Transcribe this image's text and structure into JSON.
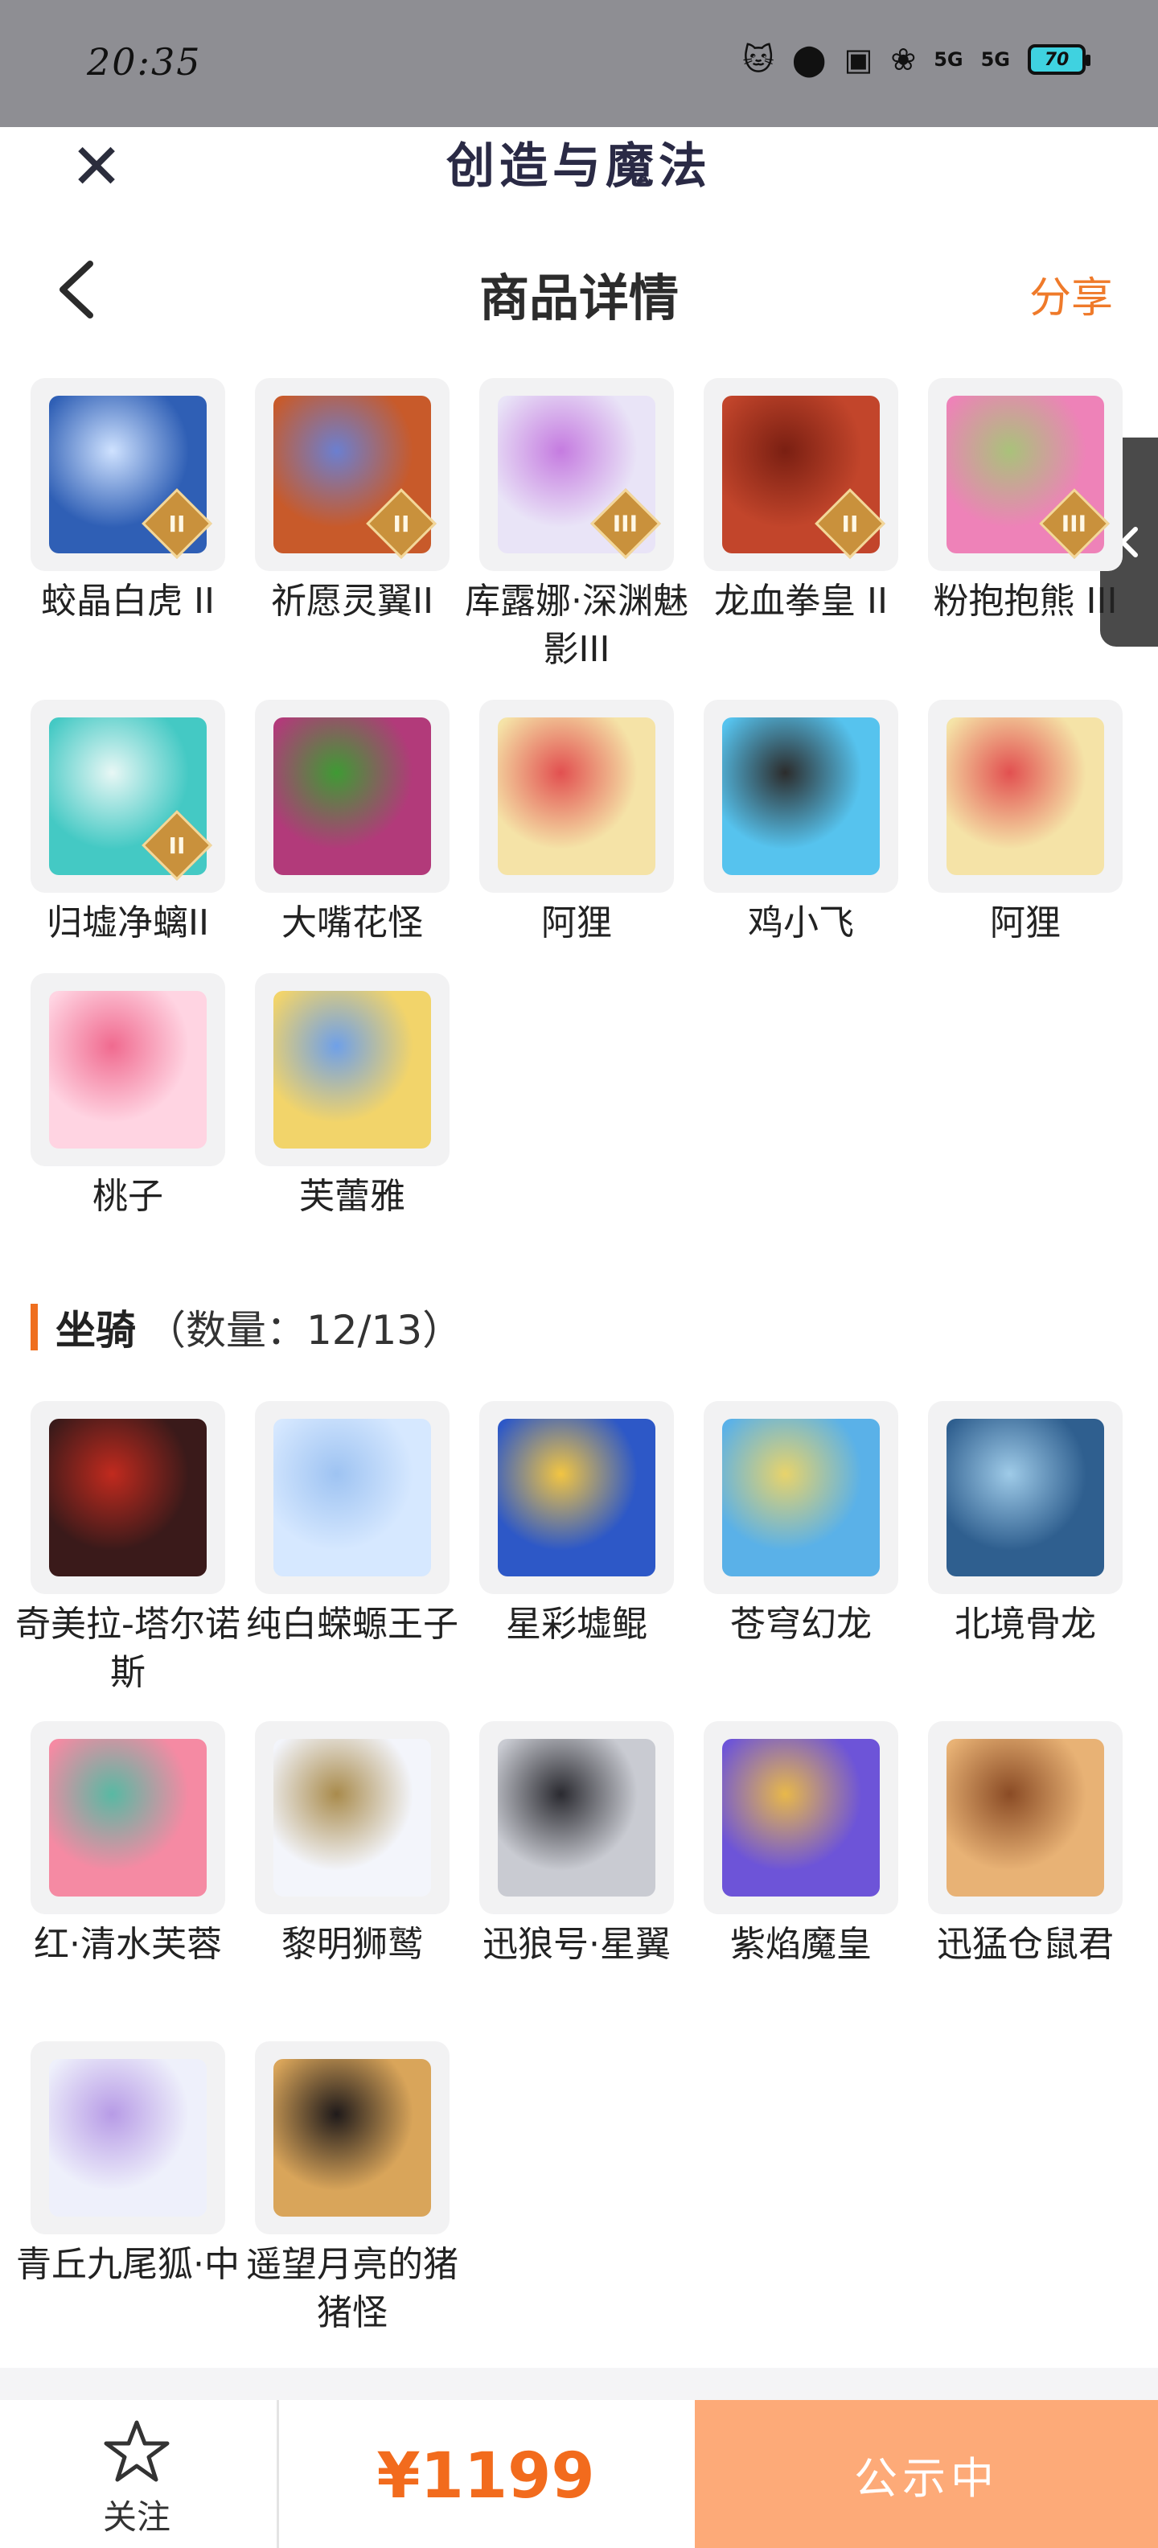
{
  "status_bar": {
    "time": "20:35",
    "signal_1": "5G",
    "signal_2": "5G",
    "battery": "70"
  },
  "header": {
    "app_title": "创造与魔法",
    "page_title": "商品详情",
    "share_label": "分享"
  },
  "pets": [
    {
      "name": "蛟晶白虎 II",
      "badge": "II",
      "colors": [
        "#2f5fb5",
        "#cfe2ff"
      ]
    },
    {
      "name": "祈愿灵翼II",
      "badge": "II",
      "colors": [
        "#c85a2a",
        "#6b7fd0"
      ]
    },
    {
      "name": "库露娜·深渊魅影III",
      "badge": "III",
      "colors": [
        "#e9e4f7",
        "#c57be0"
      ]
    },
    {
      "name": "龙血拳皇 II",
      "badge": "II",
      "colors": [
        "#c2452b",
        "#7a1f12"
      ]
    },
    {
      "name": "粉抱抱熊 III",
      "badge": "III",
      "colors": [
        "#ee82b8",
        "#a9c27a"
      ]
    },
    {
      "name": "归墟净螭II",
      "badge": "II",
      "colors": [
        "#44c9c4",
        "#e8f7f5"
      ]
    },
    {
      "name": "大嘴花怪",
      "badge": "",
      "colors": [
        "#b23a7a",
        "#3f9a34"
      ]
    },
    {
      "name": "阿狸",
      "badge": "",
      "colors": [
        "#f5e3a7",
        "#e25050"
      ]
    },
    {
      "name": "鸡小飞",
      "badge": "",
      "colors": [
        "#56c3ee",
        "#2c2c2c"
      ]
    },
    {
      "name": "阿狸",
      "badge": "",
      "colors": [
        "#f5e3a7",
        "#e25050"
      ]
    },
    {
      "name": "桃子",
      "badge": "",
      "colors": [
        "#ffd4e2",
        "#f06a8f"
      ]
    },
    {
      "name": "芙蕾雅",
      "badge": "",
      "colors": [
        "#f2d46a",
        "#6fa0e8"
      ]
    }
  ],
  "mounts_section": {
    "title": "坐骑",
    "count": "（数量：12/13）"
  },
  "mounts": [
    {
      "name": "奇美拉-塔尔诺斯",
      "badge": "",
      "colors": [
        "#3a1a1a",
        "#c12a1e"
      ]
    },
    {
      "name": "纯白蝾螈王子",
      "badge": "",
      "colors": [
        "#d6e8ff",
        "#9ec3f2"
      ]
    },
    {
      "name": "星彩墟鲲",
      "badge": "",
      "colors": [
        "#2d58c7",
        "#f2c542"
      ]
    },
    {
      "name": "苍穹幻龙",
      "badge": "",
      "colors": [
        "#5ab1e8",
        "#e8d36b"
      ]
    },
    {
      "name": "北境骨龙",
      "badge": "",
      "colors": [
        "#2f5f8f",
        "#9fcbe8"
      ]
    },
    {
      "name": "红·清水芙蓉",
      "badge": "",
      "colors": [
        "#f58aa3",
        "#58b9a3"
      ]
    },
    {
      "name": "黎明狮鹫",
      "badge": "",
      "colors": [
        "#f3f5fb",
        "#a98b4c"
      ]
    },
    {
      "name": "迅狼号·星翼",
      "badge": "",
      "colors": [
        "#c9cbd2",
        "#2a2a30"
      ]
    },
    {
      "name": "紫焰魔皇",
      "badge": "",
      "colors": [
        "#6d54d8",
        "#e8b84a"
      ]
    },
    {
      "name": "迅猛仓鼠君",
      "badge": "",
      "colors": [
        "#e8b275",
        "#8a4b25"
      ]
    },
    {
      "name": "青丘九尾狐·中",
      "badge": "",
      "colors": [
        "#eef0fb",
        "#b79be6"
      ]
    },
    {
      "name": "遥望月亮的猪猪怪",
      "badge": "",
      "colors": [
        "#d9a55a",
        "#1f1a1a"
      ]
    }
  ],
  "bottom_bar": {
    "follow_label": "关注",
    "price": "¥1199",
    "status_label": "公示中"
  }
}
